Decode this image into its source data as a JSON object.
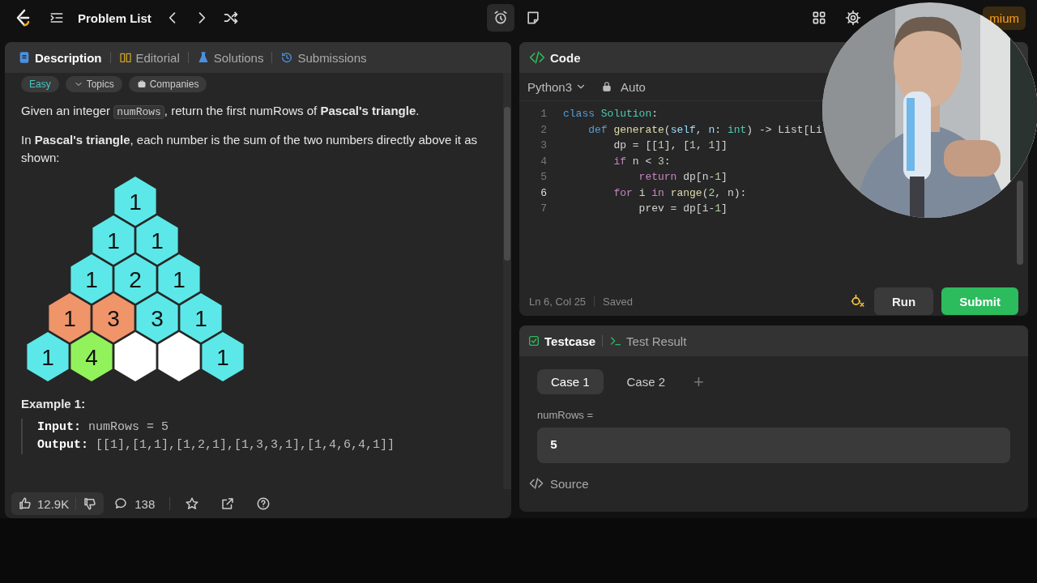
{
  "topbar": {
    "title": "Problem List",
    "premium": "mium"
  },
  "description": {
    "tabs": [
      {
        "label": "Description",
        "selected": true,
        "kind": "document"
      },
      {
        "label": "Editorial",
        "selected": false,
        "kind": "book"
      },
      {
        "label": "Solutions",
        "selected": false,
        "kind": "flask"
      },
      {
        "label": "Submissions",
        "selected": false,
        "kind": "history"
      }
    ],
    "tags": [
      {
        "label": "Easy",
        "kind": "difficulty"
      },
      {
        "label": "Topics",
        "kind": "topics"
      },
      {
        "label": "Companies",
        "kind": "companies"
      }
    ],
    "paragraphs": [
      {
        "segments": [
          {
            "kind": "text",
            "text": "Given an integer "
          },
          {
            "kind": "code",
            "text": "numRows"
          },
          {
            "kind": "text",
            "text": ", return the first numRows of **Pascal's triangle**."
          }
        ]
      },
      {
        "segments": [
          {
            "kind": "text",
            "text": "In **Pascal's triangle**, each number is the sum of the two numbers directly above it as shown:"
          }
        ]
      }
    ],
    "figure": {
      "rows": [
        [
          {
            "value": "1",
            "color": "#5ce8e8"
          }
        ],
        [
          {
            "value": "1",
            "color": "#5ce8e8"
          },
          {
            "value": "1",
            "color": "#5ce8e8"
          }
        ],
        [
          {
            "value": "1",
            "color": "#5ce8e8"
          },
          {
            "value": "2",
            "color": "#5ce8e8"
          },
          {
            "value": "1",
            "color": "#5ce8e8"
          }
        ],
        [
          {
            "value": "1",
            "color": "#f0946a"
          },
          {
            "value": "3",
            "color": "#f0946a"
          },
          {
            "value": "3",
            "color": "#5ce8e8"
          },
          {
            "value": "1",
            "color": "#5ce8e8"
          }
        ],
        [
          {
            "value": "1",
            "color": "#5ce8e8"
          },
          {
            "value": "4",
            "color": "#92f25c"
          },
          {
            "color": "#ffffff"
          },
          {
            "color": "#ffffff"
          },
          {
            "value": "1",
            "color": "#5ce8e8"
          }
        ]
      ]
    },
    "example": {
      "heading": "Example 1:",
      "lines": [
        {
          "label": "Input:",
          "value": "numRows = 5"
        },
        {
          "label": "Output:",
          "value": "[[1],[1,1],[1,2,1],[1,3,3,1],[1,4,6,4,1]]"
        }
      ]
    },
    "footer": {
      "likes": "12.9K",
      "comments": "138"
    }
  },
  "code": {
    "title": "Code",
    "language": "Python3",
    "mode": "Auto",
    "lines": [
      {
        "number": "1",
        "current": false,
        "tokens": [
          {
            "kind": "keyword",
            "text": "class"
          },
          {
            "kind": "type",
            "text": " Solution"
          },
          {
            "kind": "plain",
            "text": ":"
          }
        ]
      },
      {
        "number": "2",
        "current": false,
        "tokens": [
          {
            "kind": "keyword",
            "text": "    def"
          },
          {
            "kind": "function",
            "text": " generate"
          },
          {
            "kind": "plain",
            "text": "("
          },
          {
            "kind": "variable",
            "text": "self"
          },
          {
            "kind": "plain",
            "text": ", "
          },
          {
            "kind": "variable",
            "text": "n"
          },
          {
            "kind": "plain",
            "text": ": "
          },
          {
            "kind": "type",
            "text": "int"
          },
          {
            "kind": "plain",
            "text": ") -> List[Li"
          }
        ]
      },
      {
        "number": "3",
        "current": false,
        "tokens": [
          {
            "kind": "plain",
            "text": "        dp = [["
          },
          {
            "kind": "number",
            "text": "1"
          },
          {
            "kind": "plain",
            "text": "], ["
          },
          {
            "kind": "number",
            "text": "1"
          },
          {
            "kind": "plain",
            "text": ", "
          },
          {
            "kind": "number",
            "text": "1"
          },
          {
            "kind": "plain",
            "text": "]]"
          }
        ]
      },
      {
        "number": "4",
        "current": false,
        "tokens": [
          {
            "kind": "control",
            "text": "        if"
          },
          {
            "kind": "plain",
            "text": " n < "
          },
          {
            "kind": "number",
            "text": "3"
          },
          {
            "kind": "plain",
            "text": ":"
          }
        ]
      },
      {
        "number": "5",
        "current": false,
        "tokens": [
          {
            "kind": "control",
            "text": "            return"
          },
          {
            "kind": "plain",
            "text": " dp[n-"
          },
          {
            "kind": "number",
            "text": "1"
          },
          {
            "kind": "plain",
            "text": "]"
          }
        ]
      },
      {
        "number": "6",
        "current": true,
        "tokens": [
          {
            "kind": "control",
            "text": "        for"
          },
          {
            "kind": "plain",
            "text": " i "
          },
          {
            "kind": "control",
            "text": "in"
          },
          {
            "kind": "function",
            "text": " range"
          },
          {
            "kind": "plain",
            "text": "("
          },
          {
            "kind": "number",
            "text": "2"
          },
          {
            "kind": "plain",
            "text": ", n):"
          }
        ]
      },
      {
        "number": "7",
        "current": false,
        "tokens": [
          {
            "kind": "plain",
            "text": "            prev = dp[i-"
          },
          {
            "kind": "number",
            "text": "1"
          },
          {
            "kind": "plain",
            "text": "]"
          }
        ]
      }
    ],
    "status": {
      "position": "Ln 6, Col 25",
      "saved": "Saved"
    },
    "buttons": [
      {
        "label": "Run",
        "kind": "run"
      },
      {
        "label": "Submit",
        "kind": "submit"
      }
    ]
  },
  "testcase": {
    "tabs": [
      {
        "label": "Testcase",
        "selected": true,
        "kind": "testcase"
      },
      {
        "label": "Test Result",
        "selected": false,
        "kind": "result"
      }
    ],
    "cases": [
      {
        "label": "Case 1",
        "selected": true
      },
      {
        "label": "Case 2",
        "selected": false
      }
    ],
    "add": "+",
    "inputs": [
      {
        "label": "numRows =",
        "value": "5"
      }
    ],
    "source": "Source"
  }
}
